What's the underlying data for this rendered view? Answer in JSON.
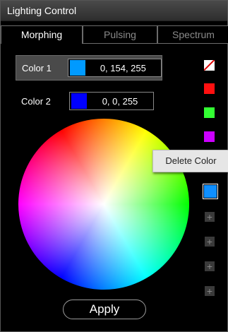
{
  "window": {
    "title": "Lighting Control"
  },
  "tabs": [
    {
      "label": "Morphing",
      "active": true
    },
    {
      "label": "Pulsing",
      "active": false
    },
    {
      "label": "Spectrum",
      "active": false
    }
  ],
  "colors": [
    {
      "label": "Color 1",
      "value": "0, 154, 255",
      "swatch": "#009aff",
      "selected": true
    },
    {
      "label": "Color 2",
      "value": "0, 0, 255",
      "swatch": "#0000ff",
      "selected": false
    }
  ],
  "palette": [
    {
      "name": "no-color",
      "color": "none"
    },
    {
      "name": "red",
      "color": "#ff1010"
    },
    {
      "name": "green",
      "color": "#33ff33"
    },
    {
      "name": "purple",
      "color": "#cc00ff"
    },
    {
      "name": "hidden",
      "color": ""
    },
    {
      "name": "light-blue",
      "color": "#0f8fff"
    }
  ],
  "tooltip": {
    "label": "Delete Color"
  },
  "apply": {
    "label": "Apply"
  },
  "icons": {
    "add_slot": "+"
  }
}
